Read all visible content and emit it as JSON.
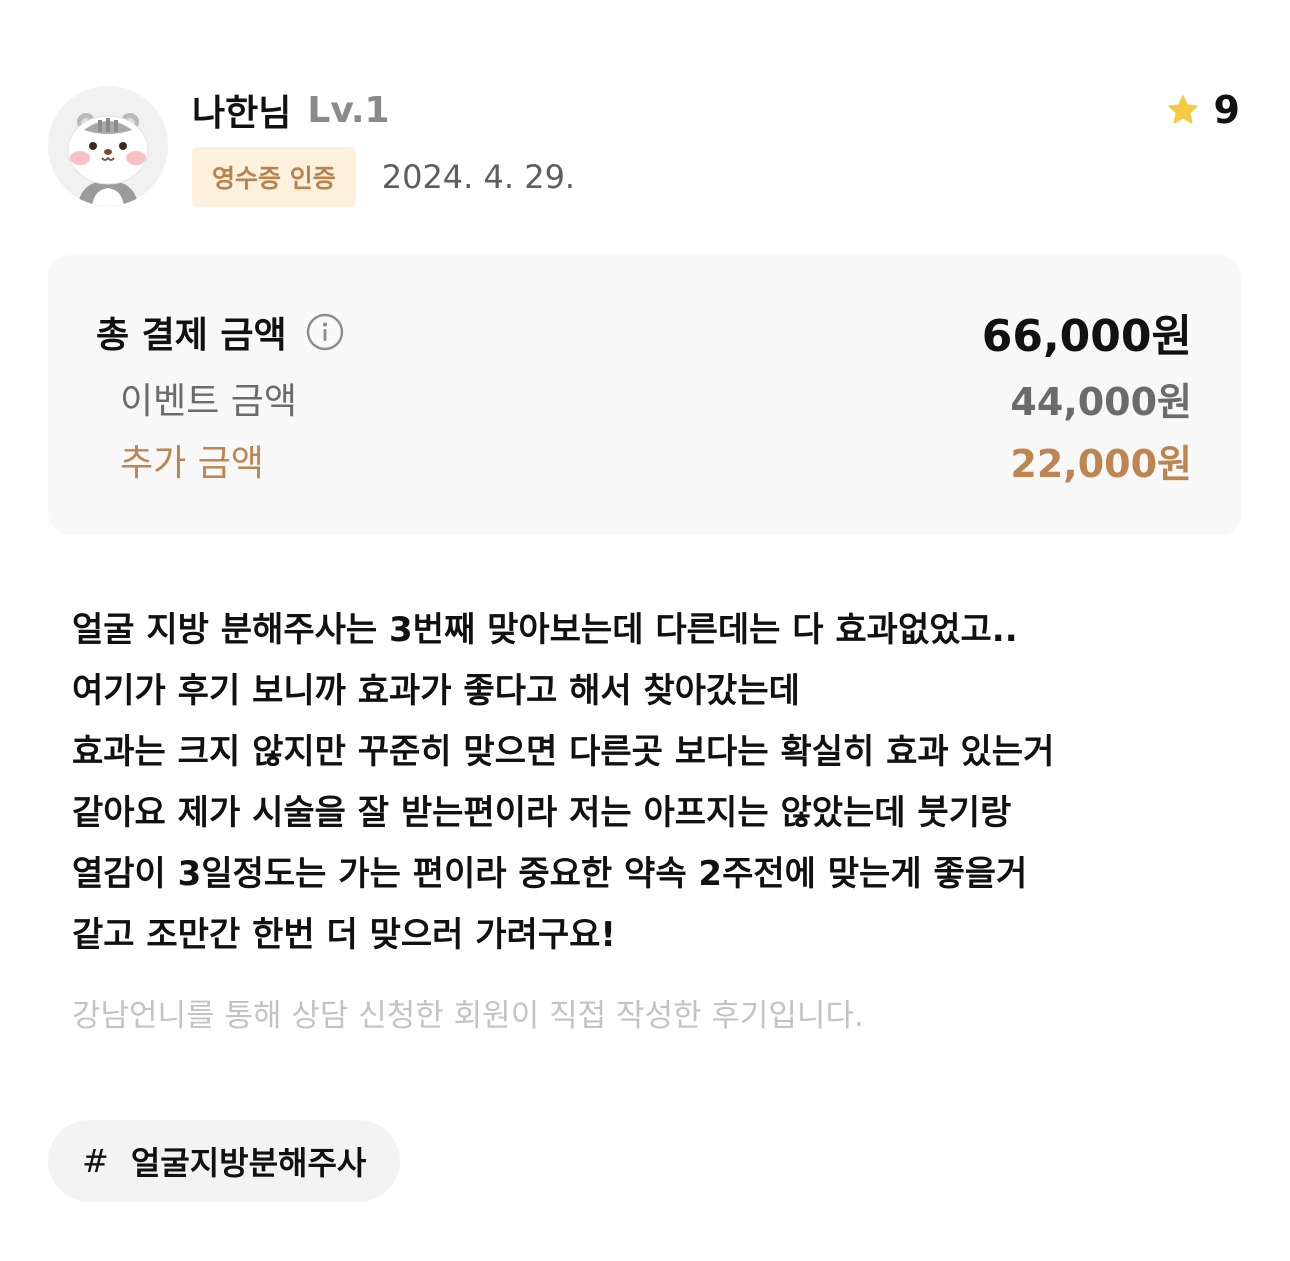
{
  "author": {
    "name": "나한님",
    "level": "Lv.1",
    "avatar_icon": "hamster-avatar-icon"
  },
  "badge": {
    "label": "영수증 인증"
  },
  "date": "2024. 4. 29.",
  "rating": {
    "icon": "star-icon",
    "value": "9",
    "star_color": "#f6c944"
  },
  "price": {
    "total_label": "총 결제 금액",
    "total_amount": "66,000원",
    "info_icon": "info-icon",
    "event_label": "이벤트 금액",
    "event_amount": "44,000원",
    "extra_label": "추가 금액",
    "extra_amount": "22,000원"
  },
  "review": {
    "lines": [
      "얼굴 지방 분해주사는 3번째 맞아보는데 다른데는 다 효과없었고..",
      "여기가 후기 보니까 효과가 좋다고 해서 찾아갔는데",
      "효과는 크지 않지만 꾸준히 맞으면 다른곳 보다는 확실히 효과 있는거",
      "같아요 제가 시술을 잘 받는편이라 저는 아프지는 않았는데 붓기랑",
      "열감이 3일정도는 가는 편이라 중요한 약속 2주전에 맞는게 좋을거",
      "같고 조만간 한번 더 맞으러 가려구요!"
    ],
    "disclaimer": "강남언니를 통해 상담 신청한 회원이 직접 작성한 후기입니다."
  },
  "tags": [
    {
      "hash": "#",
      "label": "얼굴지방분해주사"
    }
  ],
  "colors": {
    "accent_brown": "#bd8550",
    "badge_bg": "#fdf1de",
    "box_bg": "#f8f8f8"
  }
}
